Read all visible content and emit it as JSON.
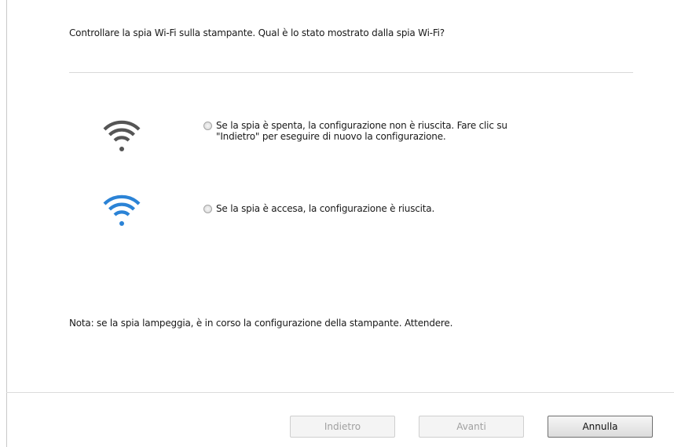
{
  "question": "Controllare la spia Wi-Fi sulla stampante. Qual è lo stato mostrato dalla spia Wi-Fi?",
  "options": [
    {
      "icon": "wifi-off-icon",
      "icon_color": "#555555",
      "line1": "Se la spia è spenta, la configurazione non è riuscita. Fare clic su",
      "line2": "\"Indietro\" per eseguire di nuovo la configurazione.",
      "selected": false
    },
    {
      "icon": "wifi-on-icon",
      "icon_color": "#2b83d6",
      "line1": "Se la spia è accesa, la configurazione è riuscita.",
      "selected": false
    }
  ],
  "note": "Nota:  se la spia lampeggia, è in corso la configurazione della stampante.  Attendere.",
  "buttons": {
    "back": "Indietro",
    "next": "Avanti",
    "cancel": "Annulla"
  }
}
